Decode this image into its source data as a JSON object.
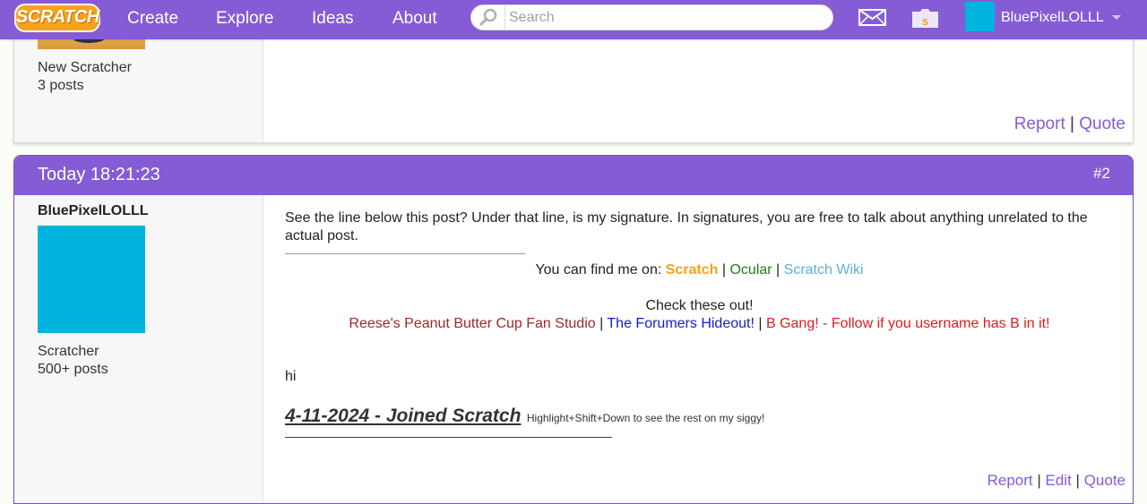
{
  "navbar": {
    "logo_text": "SCRATCH",
    "links": [
      "Create",
      "Explore",
      "Ideas",
      "About"
    ],
    "search_placeholder": "Search",
    "username": "BluePixelLOLLL",
    "brand_color": "#855cd6"
  },
  "post1": {
    "rank": "New Scratcher",
    "posts": "3 posts",
    "actions": {
      "report": "Report",
      "quote": "Quote"
    }
  },
  "post2": {
    "date": "Today 18:21:23",
    "number": "#2",
    "username": "BluePixelLOLLL",
    "rank": "Scratcher",
    "posts": "500+ posts",
    "body_text": "See the line below this post? Under that line, is my signature. In signatures, you are free to talk about anything unrelated to the actual post.",
    "signature": {
      "find_me_prefix": "You can find me on: ",
      "find_links": [
        {
          "text": "Scratch",
          "color": "#f7a21c"
        },
        {
          "text": "Ocular",
          "color": "#1e7d1e"
        },
        {
          "text": "Scratch Wiki",
          "color": "#5cb1d6"
        }
      ],
      "check_out": "Check these out!",
      "studios": [
        {
          "text": "Reese's Peanut Butter Cup Fan Studio",
          "color": "#a0282a"
        },
        {
          "text": "The Forumers Hideout!",
          "color": "#1a1ad0"
        },
        {
          "text": "B Gang! - Follow if you username has B in it!",
          "color": "#e01b1b"
        }
      ],
      "separator": " | ",
      "hi": "hi",
      "joined": "4-11-2024 - Joined Scratch",
      "joined_hint": "Highlight+Shift+Down to see the rest on my siggy!",
      "dashes": "————————————————————————————"
    },
    "actions": {
      "report": "Report",
      "edit": "Edit",
      "quote": "Quote"
    }
  }
}
